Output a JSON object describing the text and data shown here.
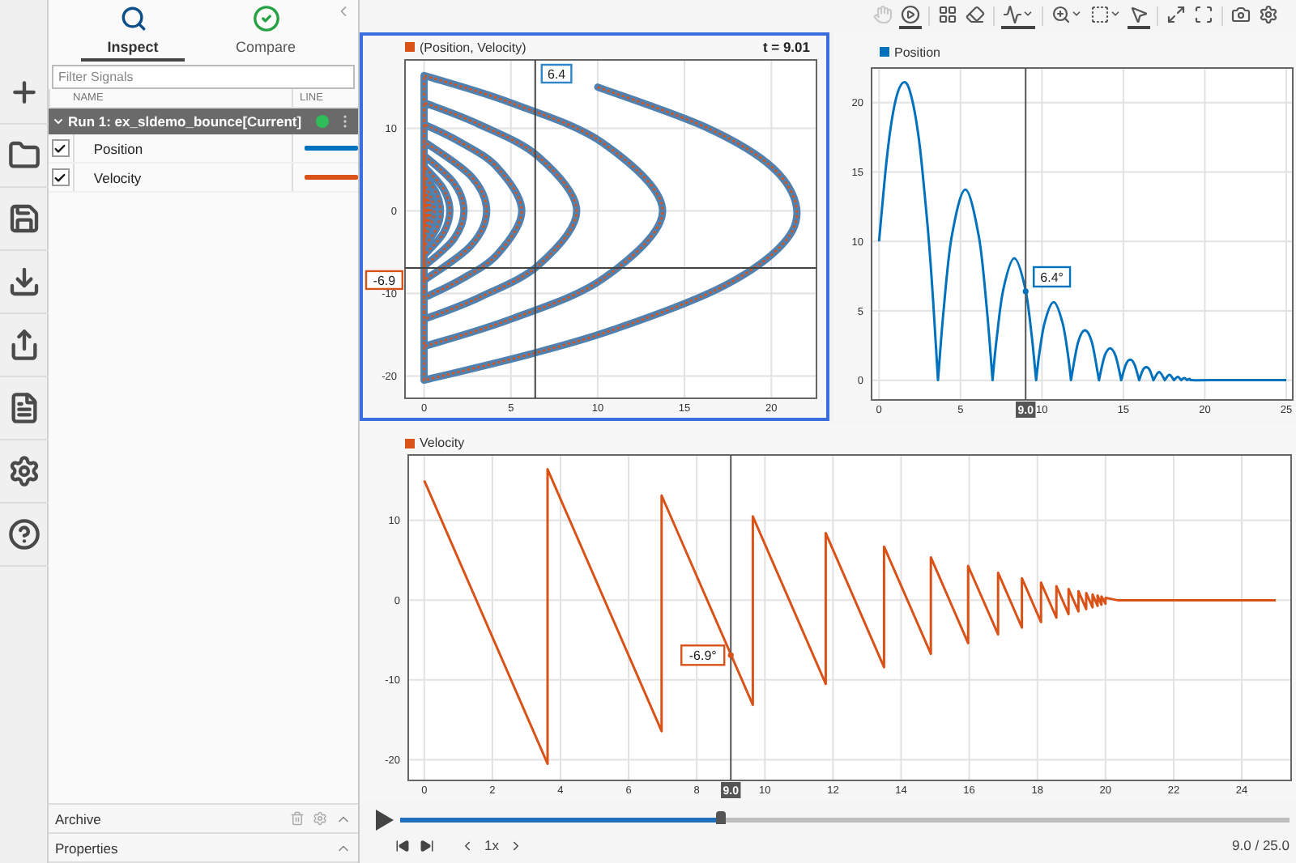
{
  "tabs": [
    {
      "label": "Inspect",
      "selected": true
    },
    {
      "label": "Compare",
      "selected": false
    }
  ],
  "filter": {
    "placeholder": "Filter Signals"
  },
  "signal_table": {
    "columns": [
      "NAME",
      "LINE"
    ],
    "runs": [
      {
        "name": "Run 1: ex_sldemo_bounce[Current]",
        "expanded": true,
        "children": [
          {
            "name": "Position",
            "checked": true,
            "color": "#0072bd"
          },
          {
            "name": "Velocity",
            "checked": true,
            "color": "#d95319"
          }
        ]
      }
    ]
  },
  "panels": [
    {
      "title": "Archive"
    },
    {
      "title": "Properties"
    }
  ],
  "toolbar": {
    "groups": [
      {
        "tools": [
          {
            "selected": false,
            "disabled": true,
            "dropdown": false
          },
          {
            "selected": true,
            "disabled": false,
            "dropdown": false
          }
        ]
      },
      {
        "tools": [
          {
            "selected": false,
            "disabled": false,
            "dropdown": false
          },
          {
            "selected": false,
            "disabled": false,
            "dropdown": false
          }
        ]
      },
      {
        "tools": [
          {
            "selected": true,
            "disabled": false,
            "dropdown": true
          }
        ]
      },
      {
        "tools": [
          {
            "selected": false,
            "disabled": false,
            "dropdown": true
          },
          {
            "selected": false,
            "disabled": false,
            "dropdown": true
          },
          {
            "selected": true,
            "disabled": false,
            "dropdown": false
          }
        ]
      },
      {
        "tools": [
          {
            "selected": false,
            "disabled": false,
            "dropdown": false
          },
          {
            "selected": false,
            "disabled": false,
            "dropdown": false
          }
        ]
      },
      {
        "tools": [
          {
            "selected": false,
            "disabled": false,
            "dropdown": false
          },
          {
            "selected": false,
            "disabled": false,
            "dropdown": false
          }
        ]
      }
    ]
  },
  "plots": [
    {
      "selected": true,
      "time_label": "t = 9.01",
      "chart_data": {
        "type": "line",
        "grid": true,
        "xlim": [
          -1.1,
          22.6
        ],
        "ylim": [
          -22.7,
          18.3
        ],
        "xticks": [
          0,
          5,
          10,
          15,
          20
        ],
        "yticks": [
          -20,
          -10,
          0,
          10
        ],
        "x": [
          10,
          16.27,
          20.1,
          21.47,
          20.38,
          16.84,
          10.85,
          6.08,
          0,
          0,
          4.95,
          10.31,
          13.74,
          10.31,
          4.95,
          0,
          0,
          3.16,
          6.59,
          8.79,
          6.59,
          3.16,
          0,
          0,
          2.03,
          4.22,
          5.63,
          4.22,
          2.03,
          0,
          0,
          2.7,
          3.6,
          2.7,
          0,
          0,
          1.73,
          2.3,
          1.73,
          0,
          0,
          1.11,
          1.48,
          1.11,
          0,
          0,
          0.71,
          0.94,
          0.71,
          0,
          0,
          0.6,
          0,
          0,
          0.39,
          0,
          0,
          0.25,
          0,
          0,
          0.16,
          0,
          0,
          0.1,
          0
        ],
        "series": [
          {
            "name": "(Position, Velocity)",
            "color": "#d95319",
            "line_style": "dotted",
            "values": [
              15,
              10.1,
              5.19,
              0,
              -4.62,
              -9.53,
              -14.43,
              -17.37,
              -20.51,
              16.42,
              13.14,
              8.21,
              0,
              -8.21,
              -13.14,
              -16.42,
              13.13,
              10.5,
              6.57,
              0,
              -6.57,
              -10.5,
              -13.13,
              10.51,
              8.41,
              5.26,
              0,
              -5.26,
              -8.41,
              -10.51,
              8.41,
              4.21,
              0,
              -4.21,
              -8.41,
              6.72,
              3.36,
              0,
              -3.36,
              -6.72,
              5.38,
              2.69,
              0,
              -2.69,
              -5.38,
              4.3,
              2.15,
              0,
              -2.15,
              -4.3,
              3.44,
              0,
              -3.44,
              2.75,
              0,
              -2.75,
              2.2,
              0,
              -2.2,
              1.76,
              0,
              -1.76,
              1.41,
              0,
              -1.41
            ]
          }
        ],
        "ref_lines": [
          {
            "axis": "x",
            "value": 6.4,
            "label": "6.4"
          },
          {
            "axis": "y",
            "value": -6.9,
            "label": "-6.9"
          }
        ]
      }
    },
    {
      "selected": false,
      "chart_data": {
        "type": "line",
        "grid": true,
        "xlim": [
          -0.46,
          25.4
        ],
        "ylim": [
          -1.42,
          22.5
        ],
        "xticks": [
          0,
          5,
          10,
          15,
          20,
          25
        ],
        "yticks": [
          0,
          5,
          10,
          15,
          20
        ],
        "x": [
          0,
          0.5,
          1,
          1.529,
          2,
          2.5,
          3,
          3.3,
          3.62,
          3.62,
          3.955,
          4.457,
          5.294,
          6.13,
          6.632,
          6.967,
          6.967,
          7.235,
          7.636,
          8.306,
          8.975,
          9.376,
          9.644,
          9.644,
          9.858,
          10.18,
          10.715,
          11.25,
          11.572,
          11.786,
          11.786,
          12.215,
          12.643,
          13.072,
          13.5,
          13.5,
          13.843,
          14.186,
          14.528,
          14.871,
          14.871,
          15.145,
          15.42,
          15.694,
          15.968,
          15.968,
          16.187,
          16.407,
          16.626,
          16.845,
          16.845,
          17.196,
          17.547,
          17.547,
          17.828,
          18.109,
          18.109,
          18.334,
          18.558,
          18.558,
          18.738,
          18.917,
          18.917,
          19.06,
          19.204,
          20.35,
          25
        ],
        "series": [
          {
            "name": "Position",
            "color": "#0072bd",
            "values": [
              10,
              16.27,
              20.1,
              21.47,
              20.38,
              16.84,
              10.85,
              6.08,
              0,
              0,
              4.95,
              10.31,
              13.74,
              10.31,
              4.95,
              0,
              0,
              3.16,
              6.59,
              8.79,
              6.59,
              3.16,
              0,
              0,
              2.03,
              4.22,
              5.63,
              4.22,
              2.03,
              0,
              0,
              2.7,
              3.6,
              2.7,
              0,
              0,
              1.73,
              2.3,
              1.73,
              0,
              0,
              1.11,
              1.48,
              1.11,
              0,
              0,
              0.71,
              0.94,
              0.71,
              0,
              0,
              0.6,
              0,
              0,
              0.39,
              0,
              0,
              0.25,
              0,
              0,
              0.16,
              0,
              0,
              0.1,
              0,
              0,
              0
            ]
          }
        ],
        "ref_lines": [
          {
            "axis": "x",
            "value": 9,
            "label": "9.0"
          }
        ],
        "annotations": [
          {
            "text": "6.4°",
            "x": 9,
            "y": 6.4
          }
        ]
      }
    },
    {
      "selected": false,
      "chart_data": {
        "type": "line",
        "grid": true,
        "xlim": [
          -0.47,
          25.45
        ],
        "ylim": [
          -22.6,
          18.2
        ],
        "xticks": [
          0,
          2,
          4,
          6,
          8,
          10,
          12,
          14,
          16,
          18,
          20,
          22,
          24
        ],
        "yticks": [
          -20,
          -10,
          0,
          10
        ],
        "x": [
          0,
          3.62,
          3.62,
          6.967,
          6.967,
          9.644,
          9.644,
          11.786,
          11.786,
          13.5,
          13.5,
          14.871,
          14.871,
          15.968,
          15.968,
          16.845,
          16.845,
          17.547,
          17.547,
          18.109,
          18.109,
          18.558,
          18.558,
          18.917,
          18.917,
          19.204,
          19.204,
          19.434,
          19.434,
          19.618,
          19.618,
          19.765,
          19.765,
          19.883,
          19.883,
          20,
          20,
          20.35,
          25
        ],
        "series": [
          {
            "name": "Velocity",
            "color": "#d95319",
            "values": [
              15,
              -20.51,
              16.42,
              -16.42,
              13.13,
              -13.13,
              10.51,
              -10.51,
              8.41,
              -8.41,
              6.72,
              -6.72,
              5.38,
              -5.38,
              4.3,
              -4.3,
              3.44,
              -3.44,
              2.75,
              -2.75,
              2.2,
              -2.2,
              1.76,
              -1.76,
              1.41,
              -1.41,
              1.13,
              -1.13,
              0.9,
              -0.9,
              0.72,
              -0.72,
              0.58,
              -0.58,
              0.46,
              -0.46,
              0.3,
              0,
              0
            ]
          }
        ],
        "ref_lines": [
          {
            "axis": "x",
            "value": 9,
            "label": "9.0"
          }
        ],
        "annotations": [
          {
            "text": "-6.9°",
            "x": 9,
            "y": -6.9
          }
        ]
      }
    }
  ],
  "playback": {
    "level": 0.36,
    "speed": "1x",
    "time": "9.0 / 25.0"
  }
}
